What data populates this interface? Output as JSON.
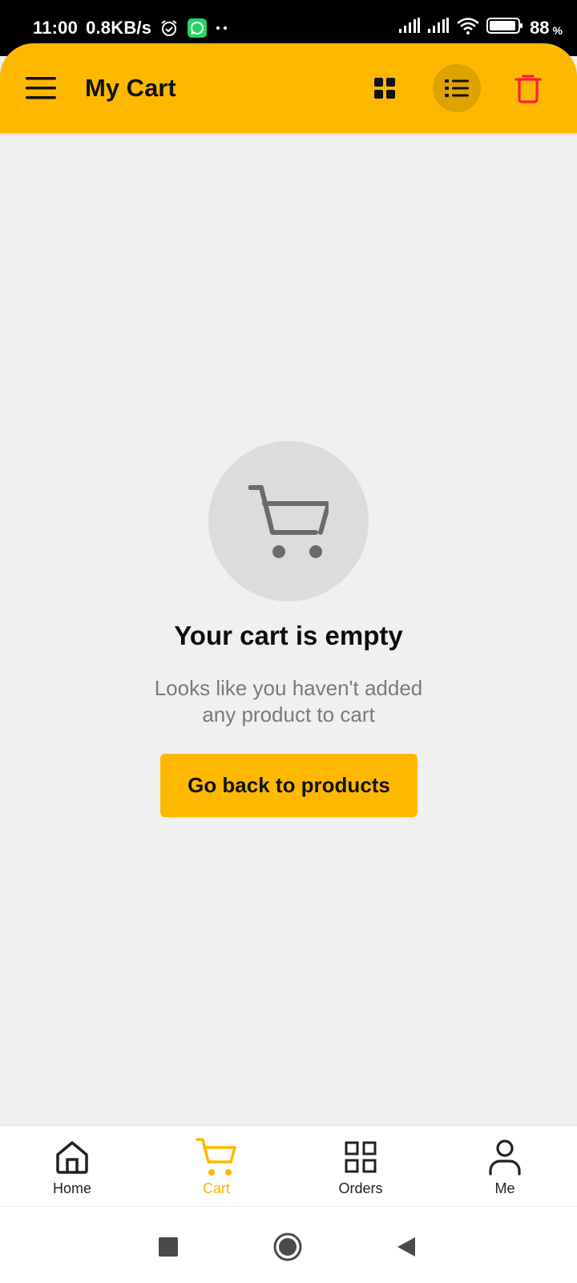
{
  "status_bar": {
    "time": "11:00",
    "speed": "0.8KB/s",
    "battery_percent": "88",
    "battery_suffix": "%",
    "icons": [
      "alarm-icon",
      "whatsapp-icon",
      "signal-icon",
      "signal-icon",
      "wifi-icon",
      "battery-icon"
    ]
  },
  "app_bar": {
    "title": "My Cart",
    "icons": [
      "menu-icon",
      "grid-view-icon",
      "list-view-icon",
      "trash-icon"
    ],
    "accent_color": "#FFB800",
    "delete_color": "#FF1E3C"
  },
  "empty_state": {
    "icon": "shopping-cart-icon",
    "title": "Your cart is empty",
    "subtitle_line1": "Looks like you haven't added",
    "subtitle_line2": "any product to cart",
    "button_label": "Go back to products"
  },
  "bottom_nav": {
    "items": [
      {
        "label": "Home",
        "icon": "home-icon",
        "active": false
      },
      {
        "label": "Cart",
        "icon": "cart-icon",
        "active": true
      },
      {
        "label": "Orders",
        "icon": "orders-grid-icon",
        "active": false
      },
      {
        "label": "Me",
        "icon": "person-icon",
        "active": false
      }
    ]
  },
  "system_nav": {
    "icons": [
      "recents-icon",
      "home-circle-icon",
      "back-icon"
    ]
  }
}
